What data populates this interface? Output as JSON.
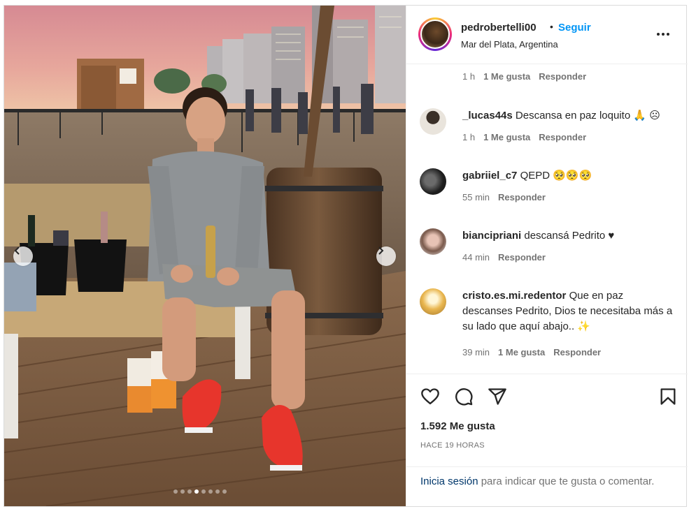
{
  "post": {
    "username": "pedrobertelli00",
    "bullet": "•",
    "follow_label": "Seguir",
    "location": "Mar del Plata, Argentina",
    "carousel": {
      "total_slides": 8,
      "active_slide": 4
    }
  },
  "comments": {
    "partial_meta": {
      "time": "1 h",
      "likes": "1 Me gusta",
      "reply": "Responder"
    },
    "items": [
      {
        "user": "_lucas44s",
        "text": "Descansa en paz loquito 🙏 ☹",
        "time": "1 h",
        "likes": "1 Me gusta",
        "reply": "Responder"
      },
      {
        "user": "gabriiel_c7",
        "text": "QEPD 🥺🥺🥺",
        "time": "55 min",
        "likes": "",
        "reply": "Responder"
      },
      {
        "user": "biancipriani",
        "text": "descansá Pedrito ♥",
        "time": "44 min",
        "likes": "",
        "reply": "Responder"
      },
      {
        "user": "cristo.es.mi.redentor",
        "text": "Que en paz descanses Pedrito, Dios te necesitaba más a su lado que aquí abajo.. ✨",
        "time": "39 min",
        "likes": "1 Me gusta",
        "reply": "Responder"
      }
    ]
  },
  "actions": {
    "like_icon": "heart-icon",
    "comment_icon": "comment-icon",
    "share_icon": "send-icon",
    "save_icon": "bookmark-icon",
    "likes_count": "1.592 Me gusta",
    "time_ago": "HACE 19 HORAS"
  },
  "login_prompt": {
    "link": "Inicia sesión",
    "text": "para indicar que te gusta o comentar."
  },
  "colors": {
    "accent": "#0095f6",
    "link": "#00376b",
    "text": "#262626",
    "muted": "#737373",
    "border": "#dbdbdb"
  }
}
